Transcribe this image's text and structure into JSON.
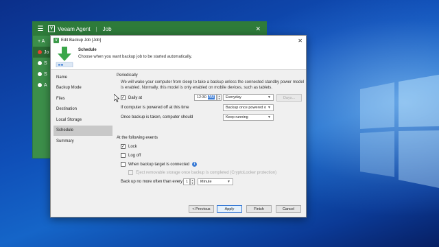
{
  "veeam": {
    "app_name": "Veeam Agent",
    "section": "Job",
    "side_items": [
      "+ A",
      "Jo",
      "S",
      "S",
      "A"
    ]
  },
  "dialog": {
    "title": "Edit Backup Job [Job]",
    "header_title": "Schedule",
    "header_subtitle": "Choose when you want backup job to be started automatically.",
    "nav": [
      "Name",
      "Backup Mode",
      "Files",
      "Destination",
      "Local Storage",
      "Schedule",
      "Summary"
    ],
    "active_nav": "Schedule"
  },
  "periodically": {
    "title": "Periodically",
    "note_line1": "We will wake your computer from sleep to take a backup unless the connected standby power model",
    "note_line2": "is enabled. Normally, this model is only enabled on mobile devices, such as tablets.",
    "daily_label": "Daily at",
    "daily_checked": true,
    "time_value": "12:30",
    "time_ampm": "AM",
    "frequency": "Everyday",
    "days_button": "Days...",
    "powered_off_label": "If computer is powered off at this time",
    "powered_off_value": "Backup once powered o",
    "after_backup_label": "Once backup is taken, computer should",
    "after_backup_value": "Keep running"
  },
  "events": {
    "title": "At the following events",
    "lock_label": "Lock",
    "lock_checked": true,
    "logoff_label": "Log off",
    "logoff_checked": false,
    "target_label": "When backup target is connected",
    "target_checked": false,
    "eject_label": "Eject removable storage once backup is completed (CryptoLocker protection)",
    "eject_checked": false,
    "limit_label": "Back up no more often than every",
    "limit_value": "1",
    "limit_unit": "Minute"
  },
  "buttons": {
    "previous": "< Previous",
    "apply": "Apply",
    "finish": "Finish",
    "cancel": "Cancel"
  },
  "colors": {
    "veeam_green": "#3c8f4a",
    "accent_blue": "#3a7bd5"
  }
}
